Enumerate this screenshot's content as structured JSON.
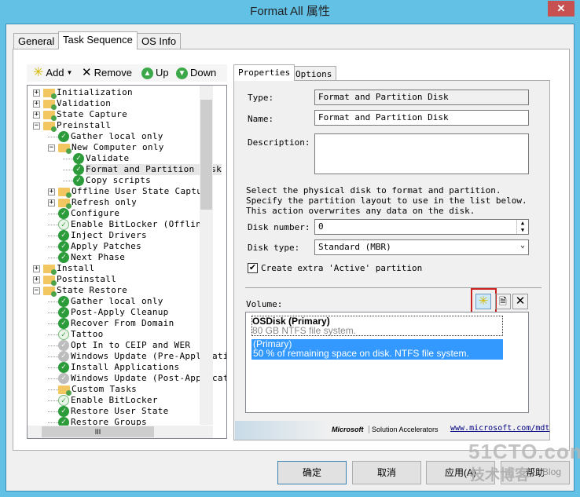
{
  "window": {
    "title": "Format All 属性",
    "close": "✕"
  },
  "tabs": [
    "General",
    "Task Sequence",
    "OS Info"
  ],
  "toolbar": {
    "add": "Add",
    "remove": "Remove",
    "up": "Up",
    "down": "Down"
  },
  "tree": [
    {
      "label": "Initialization",
      "level": 0,
      "type": "folder",
      "exp": "+"
    },
    {
      "label": "Validation",
      "level": 0,
      "type": "folder",
      "exp": "+"
    },
    {
      "label": "State Capture",
      "level": 0,
      "type": "folder",
      "exp": "+"
    },
    {
      "label": "Preinstall",
      "level": 0,
      "type": "folder",
      "exp": "-"
    },
    {
      "label": "Gather local only",
      "level": 1,
      "type": "g"
    },
    {
      "label": "New Computer only",
      "level": 1,
      "type": "folder",
      "exp": "-"
    },
    {
      "label": "Validate",
      "level": 2,
      "type": "g"
    },
    {
      "label": "Format and Partition Disk",
      "level": 2,
      "type": "g",
      "selected": true
    },
    {
      "label": "Copy scripts",
      "level": 2,
      "type": "g"
    },
    {
      "label": "Offline User State Capture",
      "level": 1,
      "type": "folder",
      "exp": "+"
    },
    {
      "label": "Refresh only",
      "level": 1,
      "type": "folder",
      "exp": "+"
    },
    {
      "label": "Configure",
      "level": 1,
      "type": "g"
    },
    {
      "label": "Enable BitLocker (Offline)",
      "level": 1,
      "type": "l"
    },
    {
      "label": "Inject Drivers",
      "level": 1,
      "type": "g"
    },
    {
      "label": "Apply Patches",
      "level": 1,
      "type": "g"
    },
    {
      "label": "Next Phase",
      "level": 1,
      "type": "g"
    },
    {
      "label": "Install",
      "level": 0,
      "type": "folder",
      "exp": "+"
    },
    {
      "label": "Postinstall",
      "level": 0,
      "type": "folder",
      "exp": "+"
    },
    {
      "label": "State Restore",
      "level": 0,
      "type": "folder",
      "exp": "-"
    },
    {
      "label": "Gather local only",
      "level": 1,
      "type": "g"
    },
    {
      "label": "Post-Apply Cleanup",
      "level": 1,
      "type": "g"
    },
    {
      "label": "Recover From Domain",
      "level": 1,
      "type": "g"
    },
    {
      "label": "Tattoo",
      "level": 1,
      "type": "l"
    },
    {
      "label": "Opt In to CEIP and WER",
      "level": 1,
      "type": "x"
    },
    {
      "label": "Windows Update (Pre-Applicatio",
      "level": 1,
      "type": "x"
    },
    {
      "label": "Install Applications",
      "level": 1,
      "type": "g"
    },
    {
      "label": "Windows Update (Post-Applicati",
      "level": 1,
      "type": "x"
    },
    {
      "label": "Custom Tasks",
      "level": 1,
      "type": "folder"
    },
    {
      "label": "Enable BitLocker",
      "level": 1,
      "type": "l"
    },
    {
      "label": "Restore User State",
      "level": 1,
      "type": "g"
    },
    {
      "label": "Restore Groups",
      "level": 1,
      "type": "g"
    }
  ],
  "props": {
    "tabs": [
      "Properties",
      "Options"
    ],
    "type_label": "Type:",
    "type_value": "Format and Partition Disk",
    "name_label": "Name:",
    "name_value": "Format and Partition Disk",
    "desc_label": "Description:",
    "desc_value": "",
    "instructions": "Select the physical disk to format and partition.  Specify the partition layout to use in the list below. This action overwrites any data on the disk.",
    "disk_number_label": "Disk number:",
    "disk_number": "0",
    "disk_type_label": "Disk type:",
    "disk_type": "Standard (MBR)",
    "active_label": "Create extra 'Active' partition",
    "active_checked": true,
    "volume_label": "Volume:",
    "volumes": [
      {
        "title": "OSDisk (Primary)",
        "detail": "80 GB NTFS file system."
      },
      {
        "title": " (Primary)",
        "detail": "50 % of remaining space on disk. NTFS file system.",
        "selected": true
      }
    ],
    "footer_brand": "Microsoft",
    "footer_product": "Solution Accelerators",
    "footer_link": "www.microsoft.com/mdt"
  },
  "buttons": {
    "ok": "确定",
    "cancel": "取消",
    "apply": "应用(A)",
    "help": "帮助"
  },
  "watermark": {
    "line1": "51CTO.com",
    "line2": "技术博客",
    "blog": "Blog"
  },
  "colors": {
    "selection": "#3399ff",
    "highlight_box": "#cc2222"
  }
}
